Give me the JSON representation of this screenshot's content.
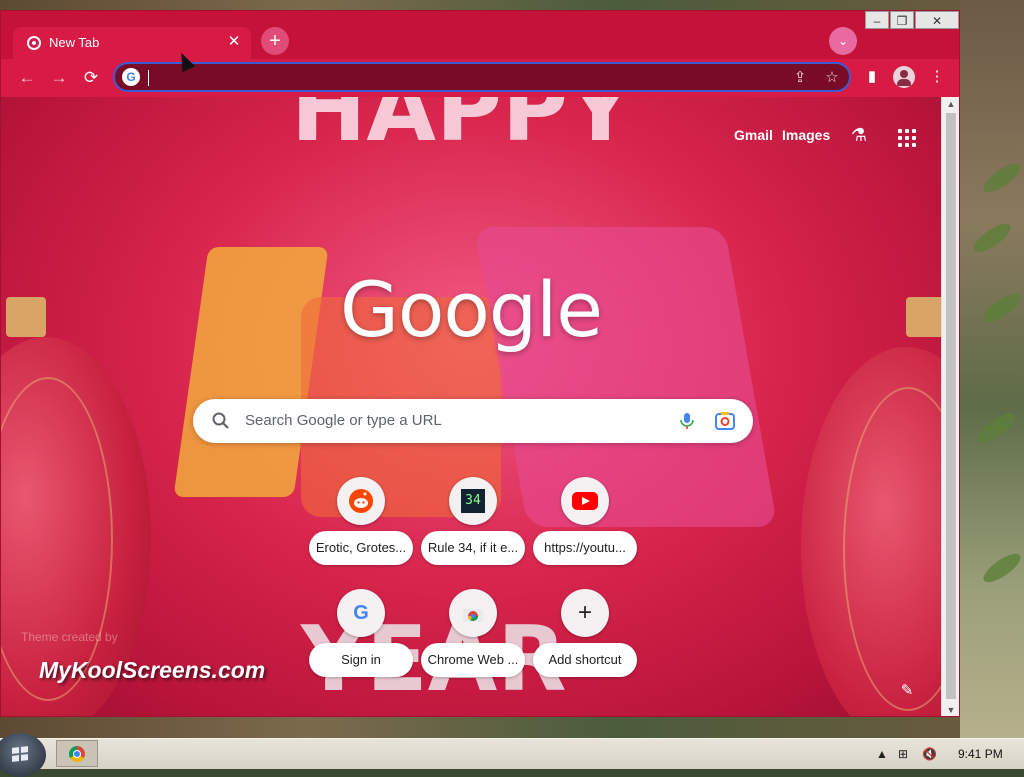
{
  "window": {
    "tab_title": "New Tab",
    "tab_close": "✕",
    "new_tab": "+",
    "tab_search": "⌄",
    "minimize": "–",
    "maximize": "❐",
    "close": "✕"
  },
  "toolbar": {
    "back": "←",
    "forward": "→",
    "reload": "⟳",
    "omnibox_icon": "G",
    "share_icon": "⇪",
    "bookmark_icon": "☆",
    "sidepanel_icon": "▮",
    "menu_icon": "⋮"
  },
  "ntp": {
    "gmail": "Gmail",
    "images": "Images",
    "labs_icon": "⚗",
    "logo": "Google",
    "search_placeholder": "Search Google or type a URL",
    "shortcuts": [
      {
        "label": "Erotic, Grotes...",
        "icon": "reddit-icon"
      },
      {
        "label": "Rule 34, if it e...",
        "icon": "rule34-icon",
        "icon_text": "34"
      },
      {
        "label": "https://youtu...",
        "icon": "youtube-icon"
      },
      {
        "label": "Sign in",
        "icon": "google-icon",
        "icon_text": "G"
      },
      {
        "label": "Chrome Web ...",
        "icon": "chrome-webstore-icon"
      },
      {
        "label": "Add shortcut",
        "icon": "plus-icon",
        "icon_text": "+"
      }
    ],
    "theme_credit_small": "Theme created by",
    "theme_credit": "MyKoolScreens.com",
    "customize_icon": "✎"
  },
  "background_letters": {
    "top": "HAPPY",
    "bottom": "YEAR"
  },
  "taskbar": {
    "clock": "9:41 PM",
    "tray_arrow": "▲",
    "tray_network": "⊞",
    "tray_volume": "🔇"
  },
  "colors": {
    "frame": "#c51238",
    "toolbar": "#d81b45",
    "omnibox_border": "#3b5bd4",
    "youtube_red": "#ff0000",
    "reddit_orange": "#ff4500"
  }
}
